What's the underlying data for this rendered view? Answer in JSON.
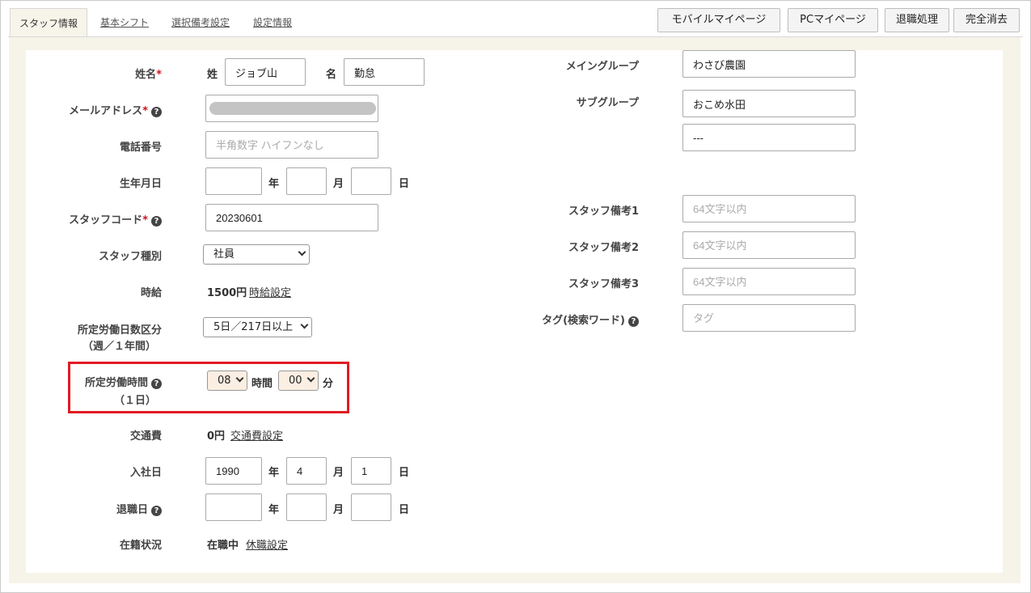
{
  "tabs": [
    {
      "label": "スタッフ情報",
      "active": true
    },
    {
      "label": "基本シフト",
      "active": false
    },
    {
      "label": "選択備考設定",
      "active": false
    },
    {
      "label": "設定情報",
      "active": false
    }
  ],
  "top_buttons": {
    "mobile": "モバイルマイページ",
    "pc": "PCマイページ",
    "retire": "退職処理",
    "delete": "完全消去"
  },
  "form": {
    "name": {
      "label": "姓名",
      "required": "*",
      "last_label": "姓",
      "last_value": "ジョブ山",
      "first_label": "名",
      "first_value": "勤怠"
    },
    "email": {
      "label": "メールアドレス",
      "required": "*"
    },
    "phone": {
      "label": "電話番号",
      "placeholder": "半角数字 ハイフンなし"
    },
    "birth": {
      "label": "生年月日",
      "year_unit": "年",
      "month_unit": "月",
      "day_unit": "日",
      "year": "",
      "month": "",
      "day": ""
    },
    "staff_code": {
      "label": "スタッフコード",
      "required": "*",
      "value": "20230601"
    },
    "staff_type": {
      "label": "スタッフ種別",
      "value": "社員"
    },
    "hourly": {
      "label": "時給",
      "value": "1500円",
      "link": "時給設定"
    },
    "work_days": {
      "label_line1": "所定労働日数区分",
      "label_line2": "（週／１年間）",
      "value": "5日／217日以上"
    },
    "work_hours": {
      "label_line1": "所定労働時間",
      "label_line2": "（１日）",
      "hours": "08",
      "hours_unit": "時間",
      "minutes": "00",
      "minutes_unit": "分"
    },
    "transport": {
      "label": "交通費",
      "value": "0円",
      "link": "交通費設定"
    },
    "join_date": {
      "label": "入社日",
      "year": "1990",
      "month": "4",
      "day": "1",
      "year_unit": "年",
      "month_unit": "月",
      "day_unit": "日"
    },
    "leave_date": {
      "label": "退職日",
      "year": "",
      "month": "",
      "day": "",
      "year_unit": "年",
      "month_unit": "月",
      "day_unit": "日"
    },
    "status": {
      "label": "在籍状況",
      "value": "在職中",
      "link": "休職設定"
    }
  },
  "right": {
    "main_group": {
      "label": "メイングループ",
      "value": "わさび農園"
    },
    "sub_group": {
      "label": "サブグループ",
      "value1": "おこめ水田",
      "value2": "---"
    },
    "note1": {
      "label": "スタッフ備考1",
      "placeholder": "64文字以内"
    },
    "note2": {
      "label": "スタッフ備考2",
      "placeholder": "64文字以内"
    },
    "note3": {
      "label": "スタッフ備考3",
      "placeholder": "64文字以内"
    },
    "tag": {
      "label": "タグ(検索ワード)",
      "placeholder": "タグ"
    }
  },
  "highlight_color": "#e01b24"
}
